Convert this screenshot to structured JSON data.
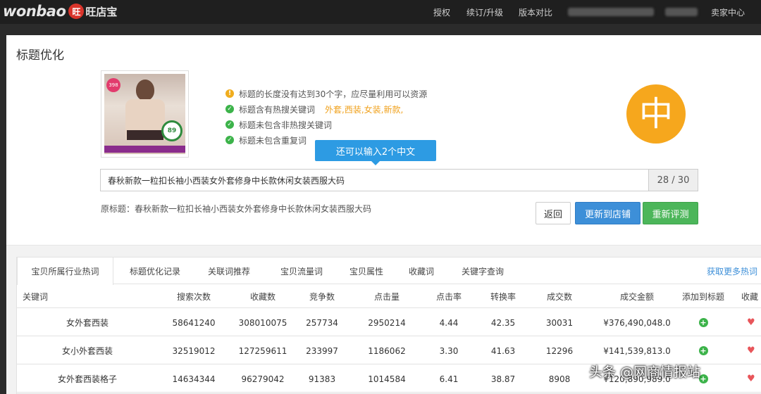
{
  "header": {
    "logo_text": "wonbao",
    "logo_mark": "旺",
    "logo_cn": "旺店宝",
    "nav": [
      "授权",
      "续订/升级",
      "版本对比",
      "卖家中心"
    ]
  },
  "modal": {
    "title": "标题优化",
    "checks": [
      {
        "type": "warn",
        "text": "标题的长度没有达到30个字，应尽量利用可以资源"
      },
      {
        "type": "ok",
        "text": "标题含有热搜关键词",
        "keywords": "外套,西装,女装,新款,"
      },
      {
        "type": "ok",
        "text": "标题未包含非热搜关键词"
      },
      {
        "type": "ok",
        "text": "标题未包含重复词"
      }
    ],
    "product_badge": "398",
    "product_score": "89",
    "big_char": "中",
    "tooltip": "还可以输入2个中文",
    "title_value": "春秋新款一粒扣长袖小西装女外套修身中长款休闲女装西服大码",
    "title_count": "28 / 30",
    "original_title": "原标题：春秋新款一粒扣长袖小西装女外套修身中长款休闲女装西服大码",
    "buttons": {
      "back": "返回",
      "sync": "更新到店铺",
      "reeval": "重新评测"
    }
  },
  "panel": {
    "tabs": [
      "宝贝所属行业热词",
      "标题优化记录",
      "关联词推荐",
      "宝贝流量词",
      "宝贝属性",
      "收藏词",
      "关键字查询"
    ],
    "more_link": "获取更多热词",
    "columns": [
      "关键词",
      "搜索次数",
      "收藏数",
      "竞争数",
      "点击量",
      "点击率",
      "转换率",
      "成交数",
      "成交金额",
      "添加到标题",
      "收藏"
    ],
    "rows": [
      {
        "keyword": "女外套西装",
        "searches": "58641240",
        "favorites": "308010075",
        "competition": "257734",
        "clicks": "2950214",
        "ctr": "4.44",
        "conversion": "42.35",
        "deals": "30031",
        "amount": "¥376,490,048.0"
      },
      {
        "keyword": "女小外套西装",
        "searches": "32519012",
        "favorites": "127259611",
        "competition": "233997",
        "clicks": "1186062",
        "ctr": "3.30",
        "conversion": "41.63",
        "deals": "12296",
        "amount": "¥141,539,813.0"
      },
      {
        "keyword": "女外套西装格子",
        "searches": "14634344",
        "favorites": "96279042",
        "competition": "91383",
        "clicks": "1014584",
        "ctr": "6.41",
        "conversion": "38.87",
        "deals": "8908",
        "amount": "¥120,890,989.0"
      }
    ]
  },
  "watermark": "头条 @网商情报站",
  "colors": {
    "accent_blue": "#3d8fd8",
    "accent_green": "#4cb65a",
    "accent_orange": "#f6a71d",
    "tooltip_blue": "#2d9be3"
  }
}
